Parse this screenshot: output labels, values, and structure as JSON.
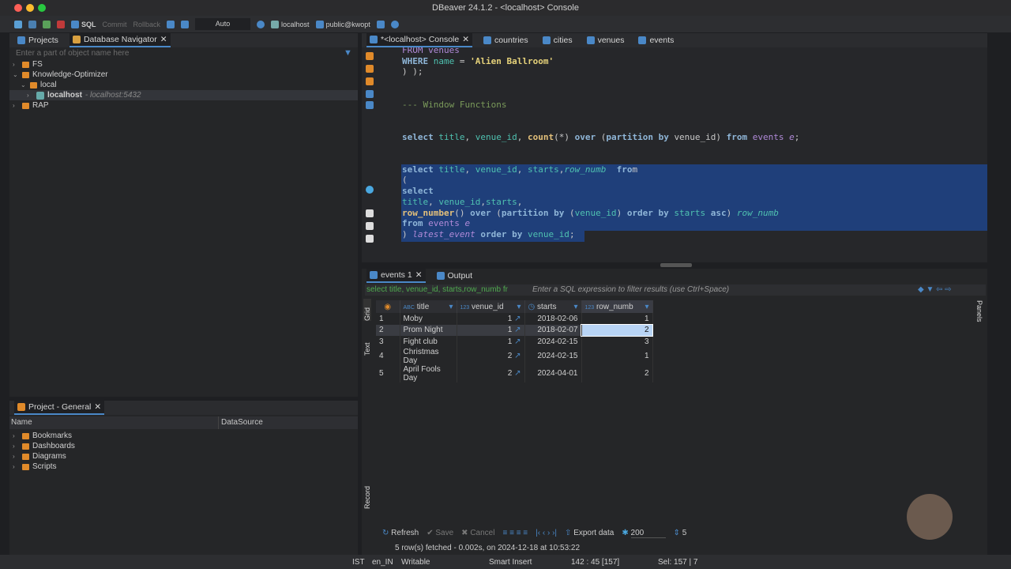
{
  "window": {
    "title": "DBeaver 24.1.2 - <localhost> Console"
  },
  "toolbar": {
    "sql": "SQL",
    "commit": "Commit",
    "rollback": "Rollback",
    "mode": "Auto",
    "connection": "localhost",
    "schema": "public@kwopt"
  },
  "navigator": {
    "tabs": [
      {
        "label": "Projects"
      },
      {
        "label": "Database Navigator"
      }
    ],
    "filter_placeholder": "Enter a part of object name here",
    "tree": [
      {
        "label": "FS",
        "expanded": false
      },
      {
        "label": "Knowledge-Optimizer",
        "expanded": true
      },
      {
        "label": "local",
        "expanded": true
      },
      {
        "label": "localhost",
        "detail": "- localhost:5432",
        "selected": true
      },
      {
        "label": "RAP",
        "expanded": false
      }
    ]
  },
  "project": {
    "title": "Project - General",
    "columns": [
      "Name",
      "DataSource"
    ],
    "items": [
      "Bookmarks",
      "Dashboards",
      "Diagrams",
      "Scripts"
    ]
  },
  "editor": {
    "tabs": [
      {
        "label": "*<localhost> Console",
        "active": true
      },
      {
        "label": "countries"
      },
      {
        "label": "cities"
      },
      {
        "label": "venues"
      },
      {
        "label": "events"
      }
    ],
    "lines": [
      [
        [
          "FROM venues",
          "tbl"
        ]
      ],
      [
        [
          "WHERE ",
          "kw"
        ],
        [
          "name",
          "id"
        ],
        [
          " = ",
          "pl"
        ],
        [
          "'Alien Ballroom'",
          "str"
        ]
      ],
      [
        [
          ") );",
          "pl"
        ]
      ],
      [],
      [],
      [
        [
          "--- Window Functions",
          "cm"
        ]
      ],
      [],
      [],
      [
        [
          "select ",
          "kw"
        ],
        [
          "title",
          "id"
        ],
        [
          ", ",
          "pl"
        ],
        [
          "venue_id",
          "id"
        ],
        [
          ", ",
          "pl"
        ],
        [
          "count",
          "fn"
        ],
        [
          "(*) ",
          "pl"
        ],
        [
          "over ",
          "kw"
        ],
        [
          "(",
          "pl"
        ],
        [
          "partition by ",
          "kw"
        ],
        [
          "venue_id) ",
          "pl"
        ],
        [
          "from ",
          "kw"
        ],
        [
          "events ",
          "tbl"
        ],
        [
          "e",
          "it2"
        ],
        [
          ";",
          "pl"
        ]
      ],
      [],
      [],
      [
        [
          "select ",
          "kw"
        ],
        [
          "title",
          "id"
        ],
        [
          ", ",
          "pl"
        ],
        [
          "venue_id",
          "id"
        ],
        [
          ", ",
          "pl"
        ],
        [
          "starts",
          "id"
        ],
        [
          ",",
          "pl"
        ],
        [
          "row_numb",
          "it"
        ],
        [
          "  fro",
          "kw"
        ],
        [
          "m",
          "pl"
        ]
      ],
      [
        [
          "(",
          "pl"
        ]
      ],
      [
        [
          "select",
          "kw"
        ]
      ],
      [
        [
          "title",
          "id"
        ],
        [
          ", ",
          "pl"
        ],
        [
          "venue_id",
          "id"
        ],
        [
          ",",
          "pl"
        ],
        [
          "starts",
          "id"
        ],
        [
          ",",
          "pl"
        ]
      ],
      [
        [
          "row_number",
          "fn"
        ],
        [
          "() ",
          "pl"
        ],
        [
          "over ",
          "kw"
        ],
        [
          "(",
          "pl"
        ],
        [
          "partition by ",
          "kw"
        ],
        [
          "(",
          "pl"
        ],
        [
          "venue_id",
          "id"
        ],
        [
          ") ",
          "pl"
        ],
        [
          "order by ",
          "kw"
        ],
        [
          "starts ",
          "id"
        ],
        [
          "asc",
          "kw"
        ],
        [
          ") ",
          "pl"
        ],
        [
          "row_numb",
          "it"
        ]
      ],
      [
        [
          "from ",
          "kw"
        ],
        [
          "events ",
          "tbl"
        ],
        [
          "e",
          "it2"
        ]
      ],
      [
        [
          ") ",
          "pl"
        ],
        [
          "latest_event ",
          "it2"
        ],
        [
          "order by ",
          "kw"
        ],
        [
          "venue_id",
          "id"
        ],
        [
          ";",
          "pl"
        ]
      ]
    ]
  },
  "results": {
    "tabs": [
      {
        "label": "events 1",
        "active": true
      },
      {
        "label": "Output"
      }
    ],
    "query_preview": "select title, venue_id, starts,row_numb fr",
    "filter_placeholder": "Enter a SQL expression to filter results (use Ctrl+Space)",
    "side_tabs": [
      "Grid",
      "Text",
      "Record"
    ],
    "right_label": "Panels",
    "columns": [
      {
        "type": "ABC",
        "name": "title"
      },
      {
        "type": "123",
        "name": "venue_id"
      },
      {
        "type": "clock",
        "name": "starts"
      },
      {
        "type": "123",
        "name": "row_numb"
      }
    ],
    "rows": [
      {
        "n": "1",
        "title": "Moby",
        "venue_id": "1",
        "starts": "2018-02-06",
        "row_numb": "1"
      },
      {
        "n": "2",
        "title": "Prom Night",
        "venue_id": "1",
        "starts": "2018-02-07",
        "row_numb": "2"
      },
      {
        "n": "3",
        "title": "Fight club",
        "venue_id": "1",
        "starts": "2024-02-15",
        "row_numb": "3"
      },
      {
        "n": "4",
        "title": "Christmas Day",
        "venue_id": "2",
        "starts": "2024-02-15",
        "row_numb": "1"
      },
      {
        "n": "5",
        "title": "April Fools Day",
        "venue_id": "2",
        "starts": "2024-04-01",
        "row_numb": "2"
      }
    ],
    "bottom": {
      "refresh": "Refresh",
      "save": "Save",
      "cancel": "Cancel",
      "export": "Export data",
      "fetch_size": "200",
      "row_count": "5"
    },
    "status": "5 row(s) fetched - 0.002s, on 2024-12-18 at 10:53:22"
  },
  "statusbar": {
    "tz": "IST",
    "locale": "en_IN",
    "mode": "Writable",
    "insert": "Smart Insert",
    "position": "142 : 45 [157]",
    "selection": "Sel: 157 | 7"
  }
}
